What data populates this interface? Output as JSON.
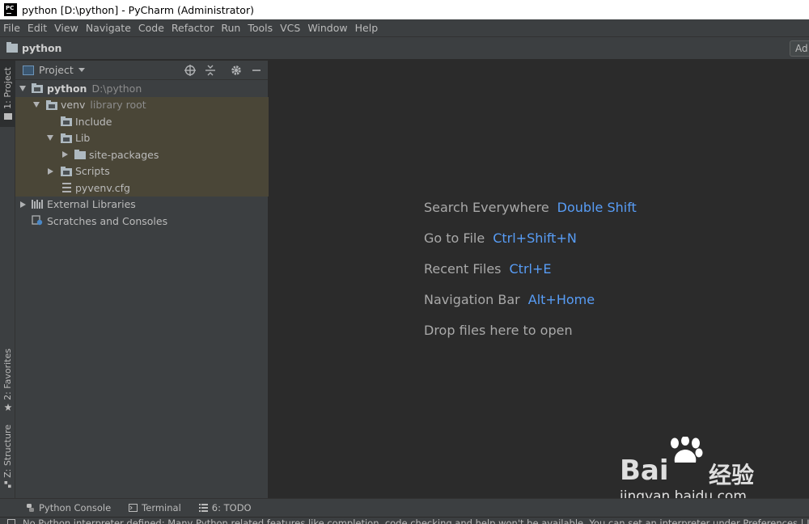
{
  "window": {
    "title": "python [D:\\python] - PyCharm (Administrator)",
    "app_icon": "pycharm-logo",
    "app_icon_text": "PC"
  },
  "menu": [
    "File",
    "Edit",
    "View",
    "Navigate",
    "Code",
    "Refactor",
    "Run",
    "Tools",
    "VCS",
    "Window",
    "Help"
  ],
  "navbar": {
    "project_name": "python",
    "add_button_label": "Ad"
  },
  "left_strip": {
    "project_tab": "1: Project",
    "favorites_tab": "2: Favorites",
    "structure_tab": "Z: Structure"
  },
  "project_panel": {
    "title": "Project",
    "tree": {
      "root_name": "python",
      "root_path": "D:\\python",
      "venv_name": "venv",
      "venv_note": "library root",
      "include": "Include",
      "lib": "Lib",
      "site_packages": "site-packages",
      "scripts": "Scripts",
      "pyvenv": "pyvenv.cfg",
      "external_libraries": "External Libraries",
      "scratches": "Scratches and Consoles"
    }
  },
  "editor": {
    "hints": [
      {
        "label": "Search Everywhere",
        "shortcut": "Double Shift"
      },
      {
        "label": "Go to File",
        "shortcut": "Ctrl+Shift+N"
      },
      {
        "label": "Recent Files",
        "shortcut": "Ctrl+E"
      },
      {
        "label": "Navigation Bar",
        "shortcut": "Alt+Home"
      },
      {
        "label": "Drop files here to open",
        "shortcut": ""
      }
    ]
  },
  "bottom_bar": {
    "python_console": "Python Console",
    "terminal": "Terminal",
    "todo": "6: TODO"
  },
  "status": {
    "message": "No Python interpreter defined: Many Python related features like completion, code checking and help won't be available. You can set an interpreter under Preferences | Language"
  },
  "watermark": {
    "brand": "Bai",
    "brand_suffix": "经验",
    "url": "jingyan.baidu.com"
  },
  "colors": {
    "background": "#2b2b2b",
    "panel": "#3c3f41",
    "shortcut_blue": "#589df6",
    "highlight_rows": "#4a4637"
  }
}
